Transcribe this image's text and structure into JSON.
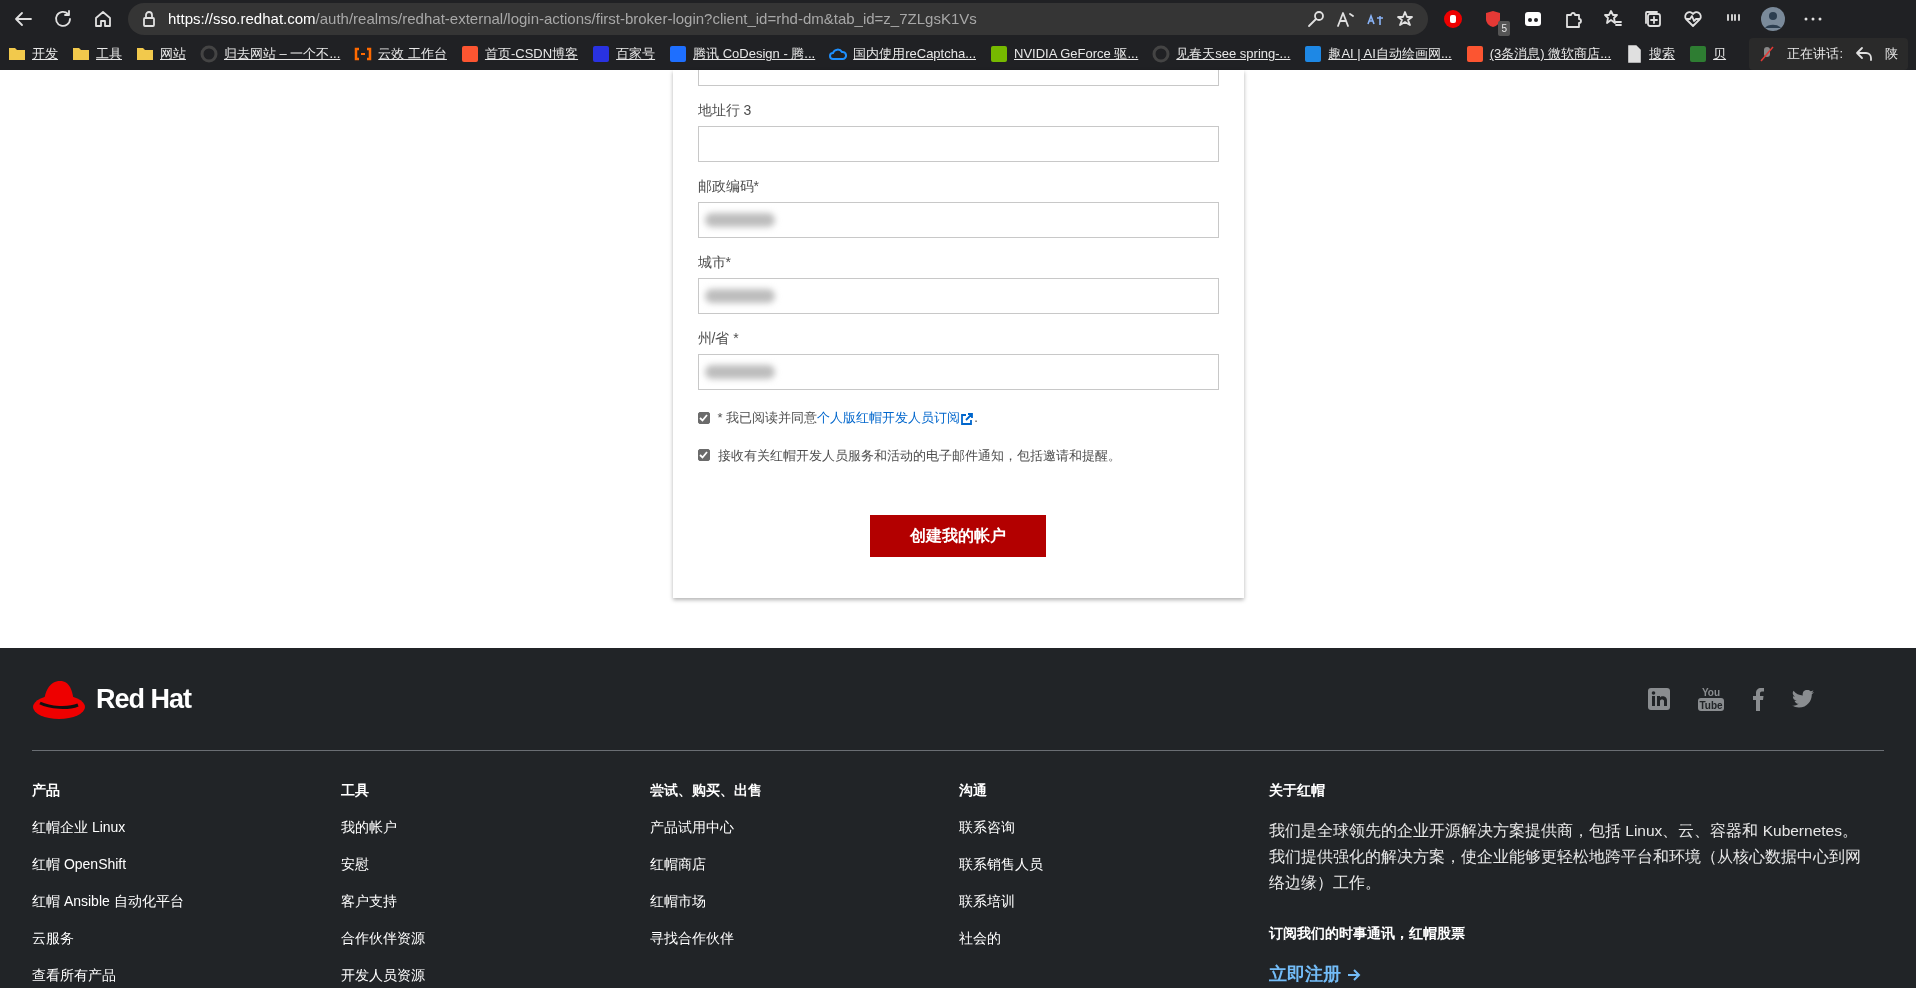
{
  "browser": {
    "url_host": "https://sso.redhat.com",
    "url_path": "/auth/realms/redhat-external/login-actions/first-broker-login?client_id=rhd-dm&tab_id=z_7ZLgsK1Vs",
    "extension_badge": "5",
    "bookmarks": [
      {
        "label": "开发",
        "kind": "folder",
        "color": "#f2c94c"
      },
      {
        "label": "工具",
        "kind": "folder",
        "color": "#f2c94c"
      },
      {
        "label": "网站",
        "kind": "folder",
        "color": "#f2c94c"
      },
      {
        "label": "归去网站 – 一个不...",
        "kind": "round",
        "color": "#444444"
      },
      {
        "label": "云效 工作台",
        "kind": "bracket",
        "color": "#ff6a00"
      },
      {
        "label": "首页-CSDN博客",
        "kind": "square",
        "color": "#fc5531"
      },
      {
        "label": "百家号",
        "kind": "square",
        "color": "#2932e1"
      },
      {
        "label": "腾讯 CoDesign - 腾...",
        "kind": "square",
        "color": "#1e6fff"
      },
      {
        "label": "国内使用reCaptcha...",
        "kind": "cloud",
        "color": "#1e90ff"
      },
      {
        "label": "NVIDIA GeForce 驱...",
        "kind": "square",
        "color": "#76b900"
      },
      {
        "label": "见春天see spring-...",
        "kind": "round",
        "color": "#444444"
      },
      {
        "label": "趣AI | AI自动绘画网...",
        "kind": "square",
        "color": "#1e88e5"
      },
      {
        "label": "(3条消息) 微软商店...",
        "kind": "square",
        "color": "#fc5531"
      },
      {
        "label": "搜索",
        "kind": "page",
        "color": "#e0e0e0"
      },
      {
        "label": "贝",
        "kind": "square",
        "color": "#2e7d32"
      }
    ],
    "speaking_label": "正在讲话:",
    "trailing_text": "陕"
  },
  "form": {
    "fields": [
      {
        "cut": true,
        "redacted": false
      },
      {
        "label": "地址行 3",
        "cut": false,
        "redacted": false
      },
      {
        "label": "邮政编码*",
        "cut": false,
        "redacted": true
      },
      {
        "label": "城市*",
        "cut": false,
        "redacted": true
      },
      {
        "label": "州/省 *",
        "cut": false,
        "redacted": true
      }
    ],
    "checkboxes": [
      {
        "text": "* 我已阅读并同意",
        "link": "个人版红帽开发人员订阅",
        "after": ".",
        "checked": true
      },
      {
        "text": "接收有关红帽开发人员服务和活动的电子邮件通知，包括邀请和提醒。",
        "checked": true
      }
    ],
    "submit": "创建我的帐户"
  },
  "footer": {
    "logo": "Red Hat",
    "social": [
      {
        "kind": "linkedin"
      },
      {
        "kind": "youtube",
        "top": "You",
        "bottom": "Tube"
      },
      {
        "kind": "facebook"
      },
      {
        "kind": "twitter"
      }
    ],
    "columns": [
      {
        "heading": "产品",
        "links": [
          "红帽企业 Linux",
          "红帽 OpenShift",
          "红帽 Ansible 自动化平台",
          "云服务",
          "查看所有产品"
        ]
      },
      {
        "heading": "工具",
        "links": [
          "我的帐户",
          "安慰",
          "客户支持",
          "合作伙伴资源",
          "开发人员资源"
        ]
      },
      {
        "heading": "尝试、购买、出售",
        "links": [
          "产品试用中心",
          "红帽商店",
          "红帽市场",
          "寻找合作伙伴"
        ]
      },
      {
        "heading": "沟通",
        "links": [
          "联系咨询",
          "联系销售人员",
          "联系培训",
          "社会的"
        ]
      }
    ],
    "about": {
      "heading": "关于红帽",
      "text": "我们是全球领先的企业开源解决方案提供商，包括 Linux、云、容器和 Kubernetes。我们提供强化的解决方案，使企业能够更轻松地跨平台和环境（从核心数据中心到网络边缘）工作。",
      "newsletter": "订阅我们的时事通讯，红帽股票",
      "signup": "立即注册"
    }
  }
}
